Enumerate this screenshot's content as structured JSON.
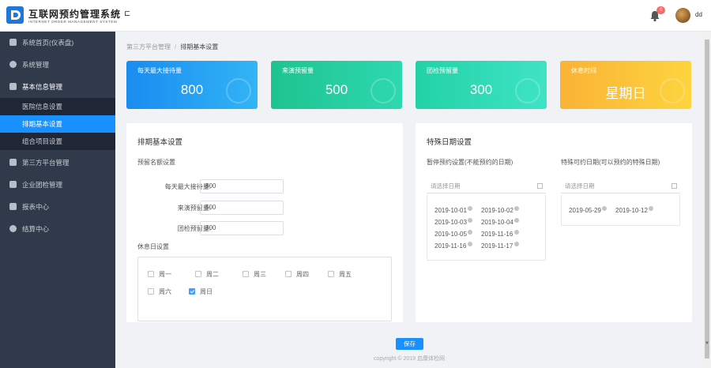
{
  "header": {
    "title": "互联网预约管理系统",
    "subtitle": "INTERNET ORDER MANAGEMENT SYSTEM",
    "collapse_glyph": "⊏",
    "badge": "0",
    "user": "dd"
  },
  "sidebar": {
    "items": [
      {
        "label": "系统首页(仪表盘)",
        "icon": "home-icon"
      },
      {
        "label": "系统管理",
        "icon": "gear-icon"
      },
      {
        "label": "基本信息管理",
        "icon": "list-icon"
      },
      {
        "label": "第三方平台管理",
        "icon": "link-icon"
      },
      {
        "label": "企业团检管理",
        "icon": "users-icon"
      },
      {
        "label": "报表中心",
        "icon": "chart-icon"
      },
      {
        "label": "结算中心",
        "icon": "money-icon"
      }
    ],
    "submenu": [
      {
        "label": "医院信息设置"
      },
      {
        "label": "排期基本设置"
      },
      {
        "label": "组合项目设置"
      }
    ]
  },
  "breadcrumb": {
    "parent": "第三方平台管理",
    "separator": "/",
    "current": "排期基本设置"
  },
  "cards": [
    {
      "label": "每天最大接待量",
      "value": "800",
      "color": "#1a8cf0"
    },
    {
      "label": "来演预留量",
      "value": "500",
      "color": "#1ec89a"
    },
    {
      "label": "团检预留量",
      "value": "300",
      "color": "#2edbb4"
    },
    {
      "label": "休息时间",
      "value": "星期日",
      "color": "#fbbb37"
    }
  ],
  "basic": {
    "title": "排期基本设置",
    "reserve_label": "预留名额设置",
    "fields": [
      {
        "label": "每天最大接待量:",
        "value": "800"
      },
      {
        "label": "来演预留量:",
        "value": "500"
      },
      {
        "label": "团检预留量:",
        "value": "300"
      }
    ],
    "weekday_label": "休息日设置",
    "weekdays": [
      {
        "label": "周一",
        "checked": false
      },
      {
        "label": "周二",
        "checked": false
      },
      {
        "label": "周三",
        "checked": false
      },
      {
        "label": "周四",
        "checked": false
      },
      {
        "label": "周五",
        "checked": false
      },
      {
        "label": "周六",
        "checked": false
      },
      {
        "label": "周日",
        "checked": true
      }
    ]
  },
  "special": {
    "title": "特殊日期设置",
    "left_label": "暂停预约设置(不能预约的日期)",
    "right_label": "特殊可约日期(可以预约的特殊日期)",
    "placeholder": "请选择日期",
    "left_dates": [
      "2019-10-01",
      "2019-10-02",
      "2019-10-03",
      "2019-10-04",
      "2019-10-05",
      "2019-11-16",
      "2019-11-16",
      "2019-11-17"
    ],
    "right_dates": [
      "2019-05-29",
      "2019-10-12"
    ]
  },
  "footer": {
    "save": "保存",
    "copyright": "copyright © 2019 启康体检网"
  }
}
